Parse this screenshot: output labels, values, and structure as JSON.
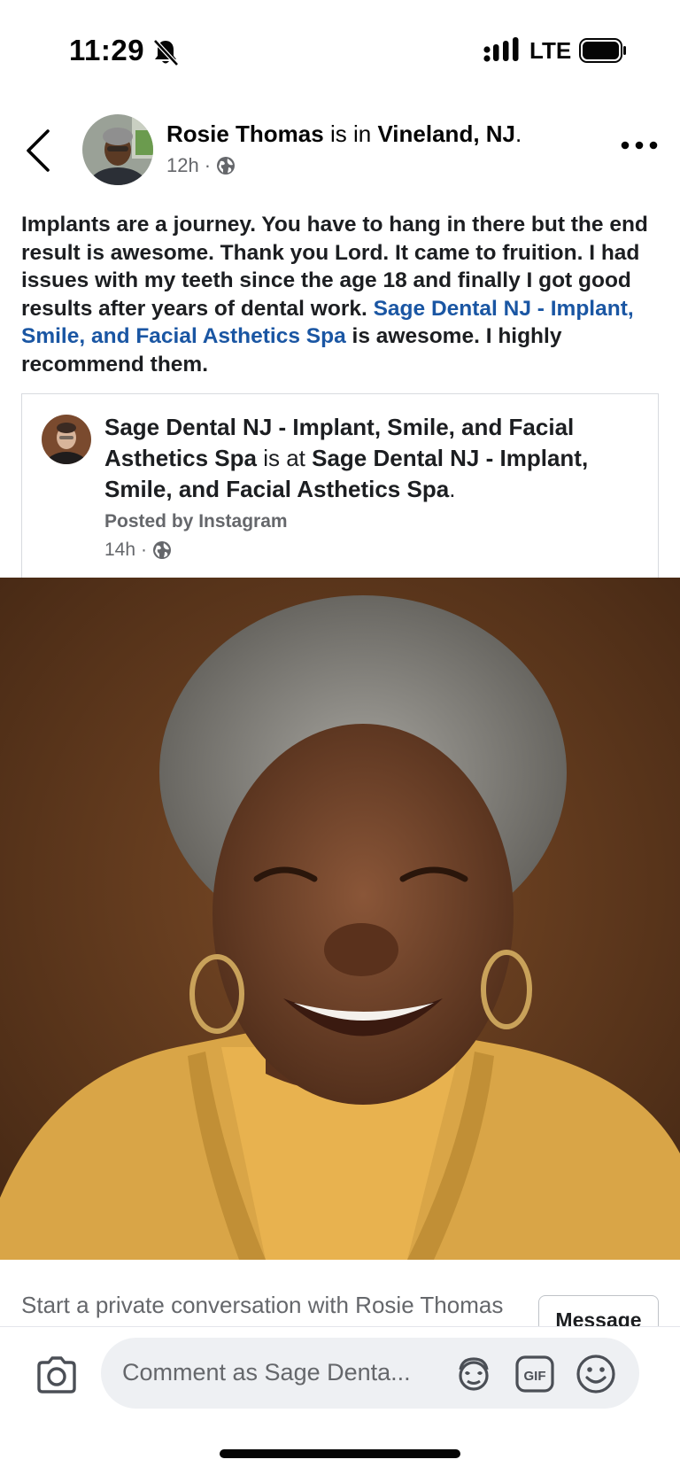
{
  "status_bar": {
    "time": "11:29",
    "network": "LTE",
    "icons": [
      "bell-slash-icon",
      "signal-icon",
      "battery-icon"
    ]
  },
  "post": {
    "author": "Rosie Thomas",
    "is_in": "is in",
    "location": "Vineland, NJ",
    "location_suffix": ".",
    "time": "12h",
    "separator": "·",
    "audience_icon": "globe-icon",
    "text_before_link": "Implants are a journey. You have to hang in there but the end result is awesome.  Thank you Lord.  It came to fruition. I had issues with my teeth since the age 18 and finally I got good results after years of dental work. ",
    "link_text": "Sage Dental NJ - Implant, Smile, and Facial Asthetics Spa",
    "text_after_link": " is awesome.  I highly recommend them."
  },
  "shared_post": {
    "page_name": "Sage Dental NJ - Implant, Smile, and Facial Asthetics Spa",
    "is_at": "is at",
    "place": "Sage Dental NJ - Implant, Smile, and Facial Asthetics Spa",
    "place_suffix": ".",
    "posted_by": "Posted by Instagram",
    "time": "14h",
    "separator": "·"
  },
  "message_strip": {
    "prompt": "Start a private conversation with Rosie Thomas in Messenger",
    "button_label": "Message"
  },
  "composer": {
    "placeholder": "Comment as Sage Denta...",
    "icons": [
      "camera-icon",
      "avatar-sticker-icon",
      "gif-icon",
      "emoji-icon"
    ]
  },
  "colors": {
    "link": "#1a56a3",
    "secondary_text": "#65676b",
    "photo_background": "#5a3418",
    "cardigan": "#d9a547"
  }
}
